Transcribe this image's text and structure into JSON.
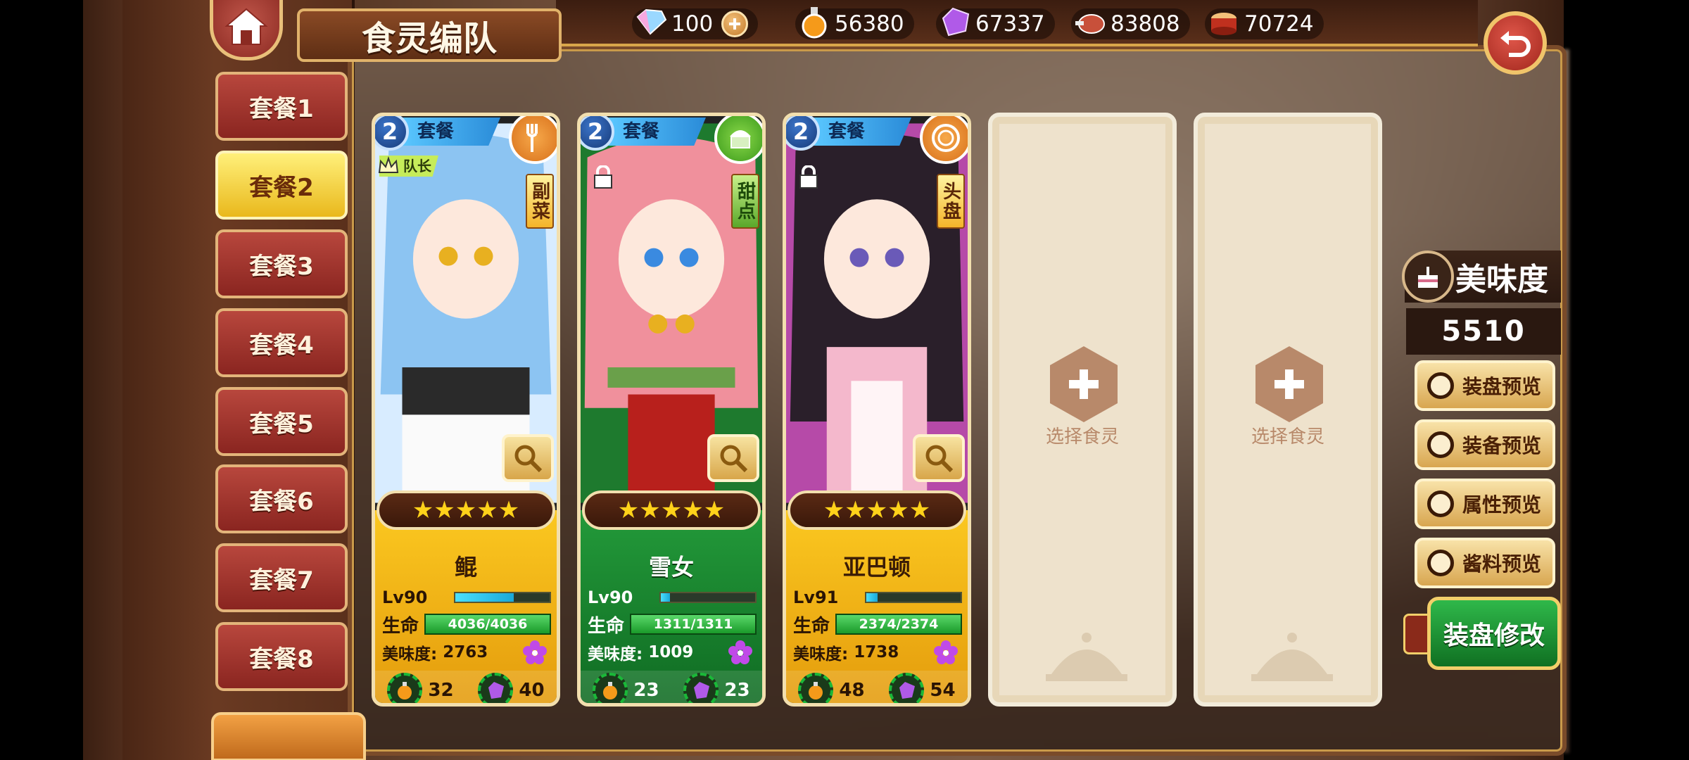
{
  "header": {
    "title": "食灵编队",
    "resources": [
      {
        "icon": "rainbow-crystal-icon",
        "value": "100",
        "has_plus": true
      },
      {
        "icon": "potion-flask-icon",
        "value": "56380",
        "has_plus": false
      },
      {
        "icon": "purple-gem-icon",
        "value": "67337",
        "has_plus": false
      },
      {
        "icon": "meat-icon",
        "value": "83808",
        "has_plus": false
      },
      {
        "icon": "drum-icon",
        "value": "70724",
        "has_plus": false
      }
    ]
  },
  "tabs": [
    "套餐1",
    "套餐2",
    "套餐3",
    "套餐4",
    "套餐5",
    "套餐6",
    "套餐7",
    "套餐8"
  ],
  "active_tab": 1,
  "cards": [
    {
      "set_number": "2",
      "set_label": "套餐",
      "type": "副菜",
      "type_icon": "fork-icon",
      "leader_label": "队长",
      "stars": 5,
      "name": "鲲",
      "level": "Lv90",
      "xp_fraction": 0.62,
      "hp_label": "生命",
      "hp": "4036/4036",
      "taste_label": "美味度:",
      "taste": "2763",
      "res1": "32",
      "res2": "40",
      "theme": "gold"
    },
    {
      "set_number": "2",
      "set_label": "套餐",
      "type": "甜点",
      "type_icon": "cake-icon",
      "leader_label": "",
      "stars": 5,
      "name": "雪女",
      "level": "Lv90",
      "xp_fraction": 0.1,
      "hp_label": "生命",
      "hp": "1311/1311",
      "taste_label": "美味度:",
      "taste": "1009",
      "res1": "23",
      "res2": "23",
      "theme": "green"
    },
    {
      "set_number": "2",
      "set_label": "套餐",
      "type": "头盘",
      "type_icon": "plate-icon",
      "leader_label": "",
      "stars": 5,
      "name": "亚巴顿",
      "level": "Lv91",
      "xp_fraction": 0.12,
      "hp_label": "生命",
      "hp": "2374/2374",
      "taste_label": "美味度:",
      "taste": "1738",
      "res1": "48",
      "res2": "54",
      "theme": "gold"
    }
  ],
  "empty_slots": [
    "选择食灵",
    "选择食灵"
  ],
  "right_panel": {
    "title": "美味度",
    "score": "5510",
    "buttons": [
      "装盘预览",
      "装备预览",
      "属性预览",
      "酱料预览"
    ],
    "modify": "装盘修改"
  },
  "colors": {
    "accent_gold": "#e9b81c",
    "tab_red": "#a8352e",
    "card_green": "#1a8a30"
  }
}
